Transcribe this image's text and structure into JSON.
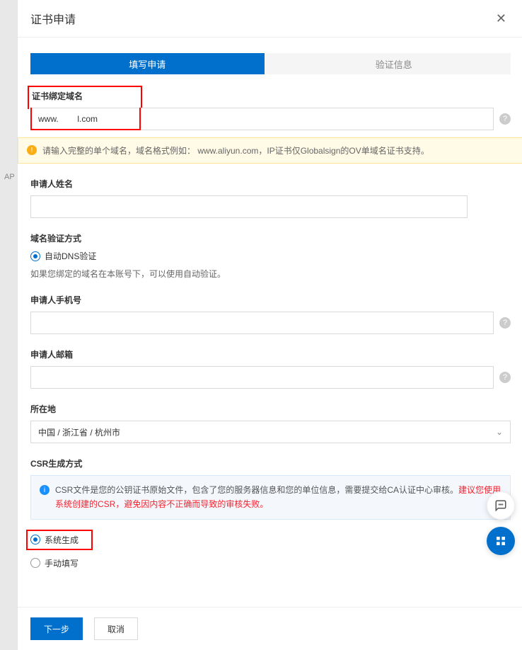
{
  "backdrop": {
    "text": "AP"
  },
  "header": {
    "title": "证书申请",
    "close_icon": "close"
  },
  "steps": {
    "active": "填写申请",
    "inactive": "验证信息"
  },
  "domain": {
    "label": "证书绑定域名",
    "value": "www.        l.com",
    "warn": "请输入完整的单个域名，域名格式例如：  www.aliyun.com，IP证书仅Globalsign的OV单域名证书支持。"
  },
  "applicant_name": {
    "label": "申请人姓名",
    "value": "      "
  },
  "verify": {
    "label": "域名验证方式",
    "option1": "自动DNS验证",
    "hint": "如果您绑定的域名在本账号下，可以使用自动验证。"
  },
  "phone": {
    "label": "申请人手机号",
    "value": "           "
  },
  "email": {
    "label": "申请人邮箱",
    "value": "                "
  },
  "location": {
    "label": "所在地",
    "value": "中国 / 浙江省 / 杭州市"
  },
  "csr": {
    "label": "CSR生成方式",
    "info_plain": "CSR文件是您的公钥证书原始文件，包含了您的服务器信息和您的单位信息，需要提交给CA认证中心审核。",
    "info_red": "建议您使用系统创建的CSR，避免因内容不正确而导致的审核失败。",
    "option_system": "系统生成",
    "option_manual": "手动填写"
  },
  "footer": {
    "next": "下一步",
    "cancel": "取消"
  },
  "float": {
    "chat_icon": "chat",
    "grid_icon": "apps"
  }
}
